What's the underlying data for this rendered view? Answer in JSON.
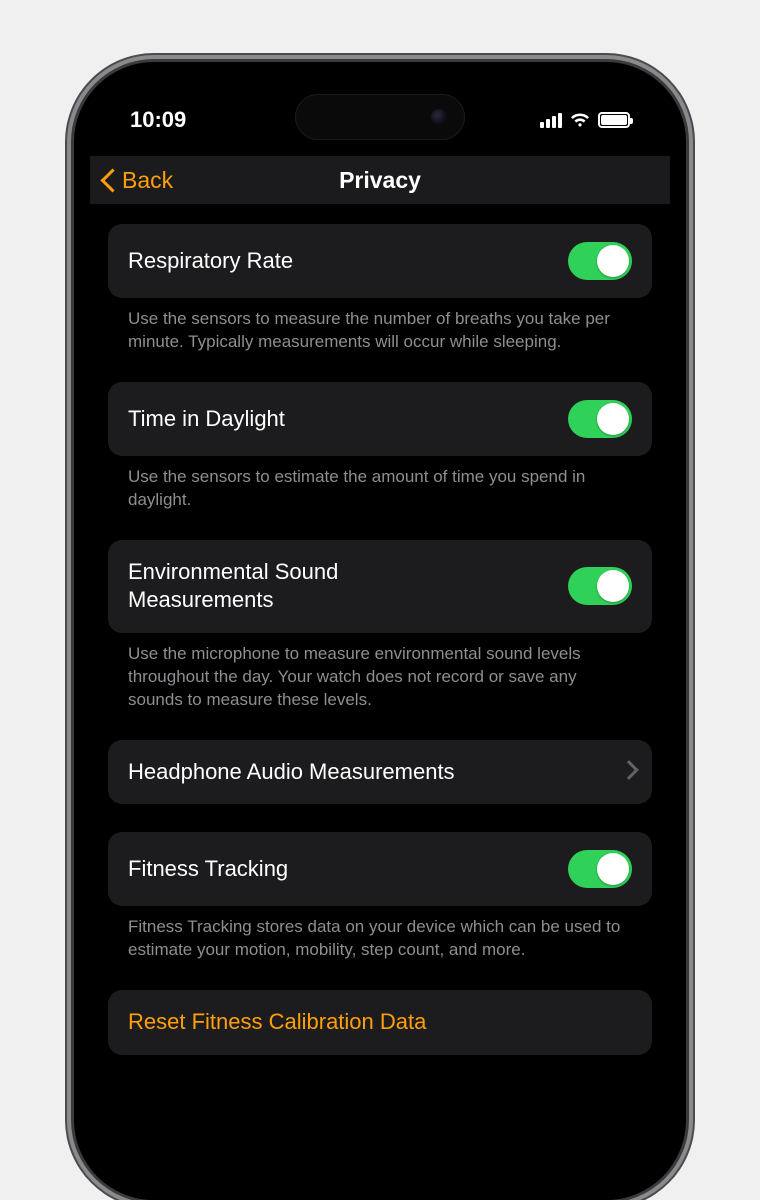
{
  "status": {
    "time": "10:09"
  },
  "nav": {
    "back": "Back",
    "title": "Privacy"
  },
  "rows": {
    "respiratory": {
      "title": "Respiratory Rate",
      "note": "Use the sensors to measure the number of breaths you take per minute. Typically measurements will occur while sleeping.",
      "on": true
    },
    "daylight": {
      "title": "Time in Daylight",
      "note": "Use the sensors to estimate the amount of time you spend in daylight.",
      "on": true
    },
    "envsound": {
      "title": "Environmental Sound Measurements",
      "note": "Use the microphone to measure environmental sound levels throughout the day. Your watch does not record or save any sounds to measure these levels.",
      "on": true
    },
    "headphone": {
      "title": "Headphone Audio Measurements"
    },
    "fitness": {
      "title": "Fitness Tracking",
      "note": "Fitness Tracking stores data on your device which can be used to estimate your motion, mobility, step count, and more.",
      "on": true
    },
    "reset": {
      "title": "Reset Fitness Calibration Data"
    }
  },
  "colors": {
    "accent": "#ff9f0a",
    "toggle_on": "#30d158"
  }
}
